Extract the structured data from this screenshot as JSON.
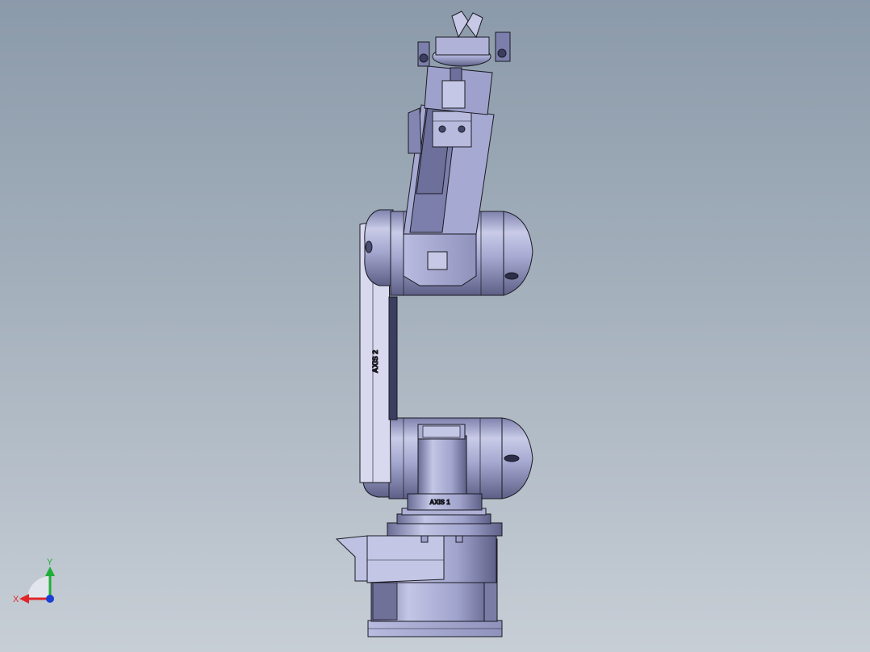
{
  "model": {
    "axis1_label": "AXIS 1",
    "axis2_label": "AXIS 2"
  },
  "triad": {
    "x_label": "X",
    "y_label": "Y",
    "x_color": "#e0262b",
    "y_color": "#1fae38",
    "z_color": "#1a3fd6"
  },
  "colors": {
    "metal_light": "#c9cbe6",
    "metal_mid": "#9b9dc4",
    "metal_dark": "#6b6d94",
    "edge": "#1a1a22"
  }
}
